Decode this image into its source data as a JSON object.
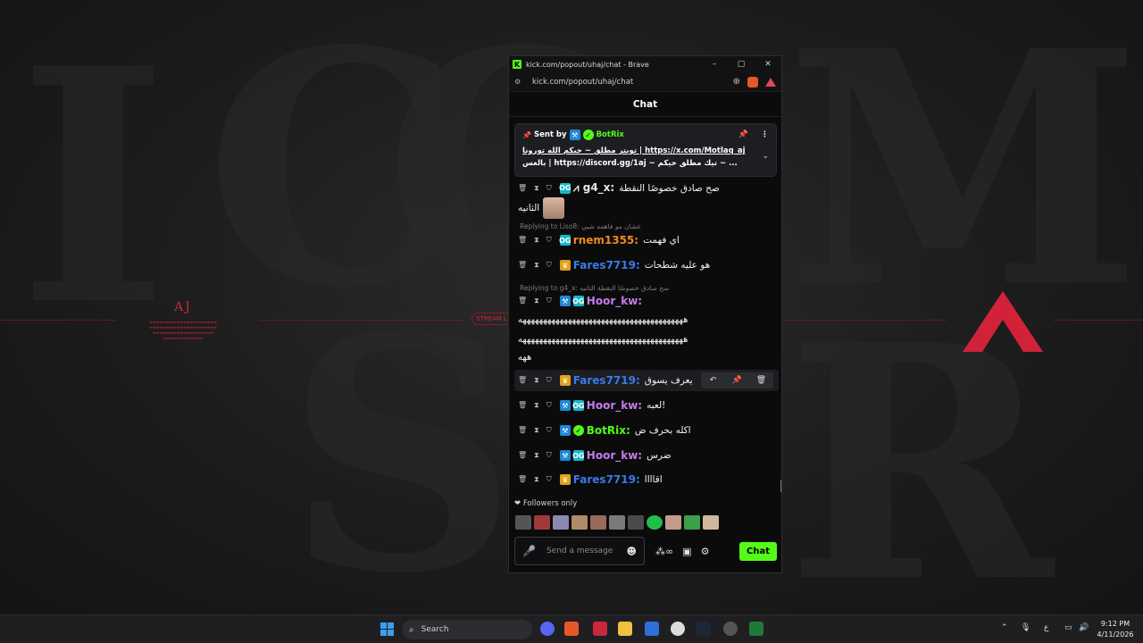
{
  "window": {
    "title": "kick.com/popout/uhaj/chat - Brave",
    "url": "kick.com/popout/uhaj/chat",
    "controls": [
      "–",
      "▢",
      "✕"
    ]
  },
  "chat": {
    "title": "Chat",
    "pinned": {
      "sent_by_label": "Sent by",
      "author": "BotRix",
      "line1": "تويتر مطلق ~ حيكم الله تورونا | https://x.com/Motlaq_aj",
      "line2": "بالعس | https://discord.gg/1aj ~ تيك مطلق حيكم ~ ..."
    },
    "messages": [
      {
        "user": "g4_x",
        "color": "#e8e8e8",
        "text": "صح صادق خصوصًا النقطة",
        "text2": "الثانيه"
      },
      {
        "reply": "Replying to Liso8: عشان مو فاهمه شيي",
        "user": "rnem1355",
        "color": "#f08a1c",
        "text": "اي فهمت"
      },
      {
        "user": "Fares7719",
        "color": "#3a7be8",
        "text": "هو عليه شطحات"
      },
      {
        "reply": "Replying to g4_x: صح صادق خصوصًا النقطة الثانيه",
        "user": "Hoor_kw",
        "color": "#c47cf0",
        "text": ""
      },
      {
        "user": "Fares7719",
        "color": "#3a7be8",
        "text": "يعرف يسوق"
      },
      {
        "user": "Hoor_kw",
        "color": "#c47cf0",
        "text": "لعبه!"
      },
      {
        "user": "BotRix",
        "color": "#53fc18",
        "text": "اكله بحرف ض"
      },
      {
        "user": "Hoor_kw",
        "color": "#c47cf0",
        "text": "ضرس"
      },
      {
        "user": "Fares7719",
        "color": "#3a7be8",
        "text": "اقاااا"
      }
    ],
    "long_line_1": "ههههههههههههههههههههههههههههههههههههههههه",
    "long_line_2": "ههههههههههههههههههههههههههههههههههههههههه",
    "long_line_3": "ههه",
    "followers_label": "Followers only",
    "input_placeholder": "Send a message",
    "send_label": "Chat"
  },
  "desktop": {
    "aj_title": "AJ",
    "stream_label": "STREAM L"
  },
  "taskbar": {
    "search_placeholder": "Search",
    "time": "9:12 PM",
    "date": "4/11/2026",
    "lang": "ع"
  },
  "colors": {
    "kick_green": "#53fc18",
    "accent_red": "#c8283a"
  }
}
